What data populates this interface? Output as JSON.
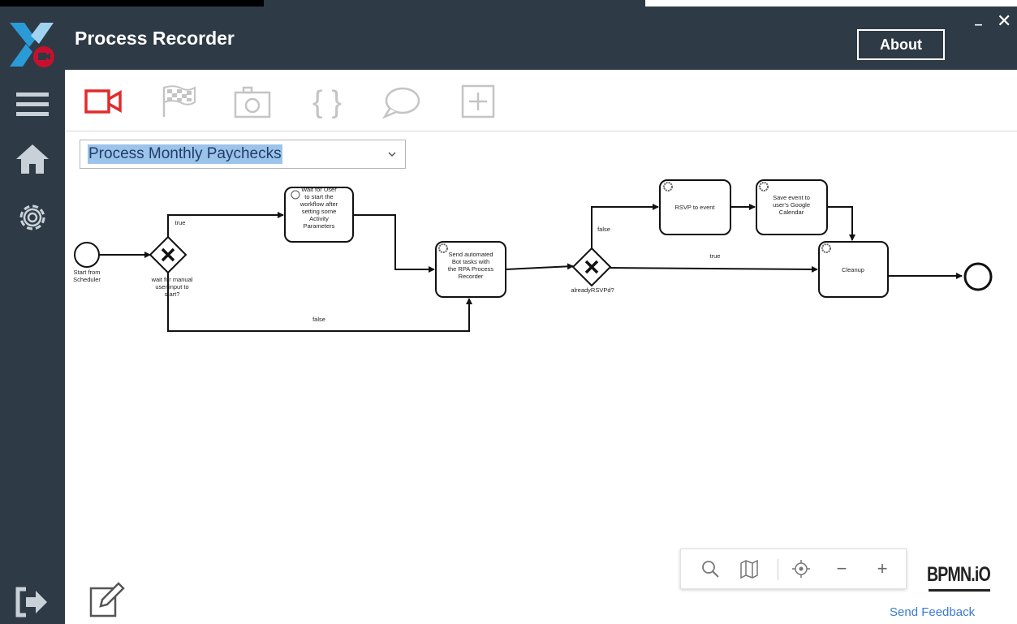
{
  "app": {
    "title": "Process Recorder"
  },
  "header": {
    "about_label": "About",
    "minimize_glyph": "–",
    "close_glyph": "✕"
  },
  "sidebar": {
    "items": [
      {
        "icon": "menu-icon"
      },
      {
        "icon": "home-icon"
      },
      {
        "icon": "settings-icon"
      },
      {
        "icon": "logout-icon"
      }
    ]
  },
  "toolbar": {
    "items": [
      {
        "icon": "record-video-icon",
        "color": "#e12b2b"
      },
      {
        "icon": "checkered-flag-icon"
      },
      {
        "icon": "camera-icon"
      },
      {
        "icon": "braces-icon"
      },
      {
        "icon": "comment-icon"
      },
      {
        "icon": "add-icon"
      }
    ]
  },
  "process_select": {
    "value": "Process Monthly Paychecks",
    "caret": "⌄"
  },
  "diagram": {
    "start_event": "Start from Scheduler",
    "gateway1": "wait for manual user input to start?",
    "gateway1_true": "true",
    "gateway1_false": "false",
    "task_wait": "Wait for User to start the workflow after setting some Activity Parameters",
    "task_send": "Send automated Bot tasks with the RPA Process Recorder",
    "gateway2": "alreadyRSVPd?",
    "gateway2_false": "false",
    "gateway2_true": "true",
    "task_rsvp": "RSVP to event",
    "task_save": "Save event to user's Google Calendar",
    "task_cleanup": "Cleanup"
  },
  "zoom_controls": {
    "minus": "−",
    "plus": "+"
  },
  "footer": {
    "bpmn_logo": "BPMN.iO",
    "feedback": "Send Feedback"
  },
  "colors": {
    "chrome": "#2e3a45",
    "record": "#e12b2b",
    "selection": "#9cc3ea",
    "link": "#3a7ad4"
  }
}
